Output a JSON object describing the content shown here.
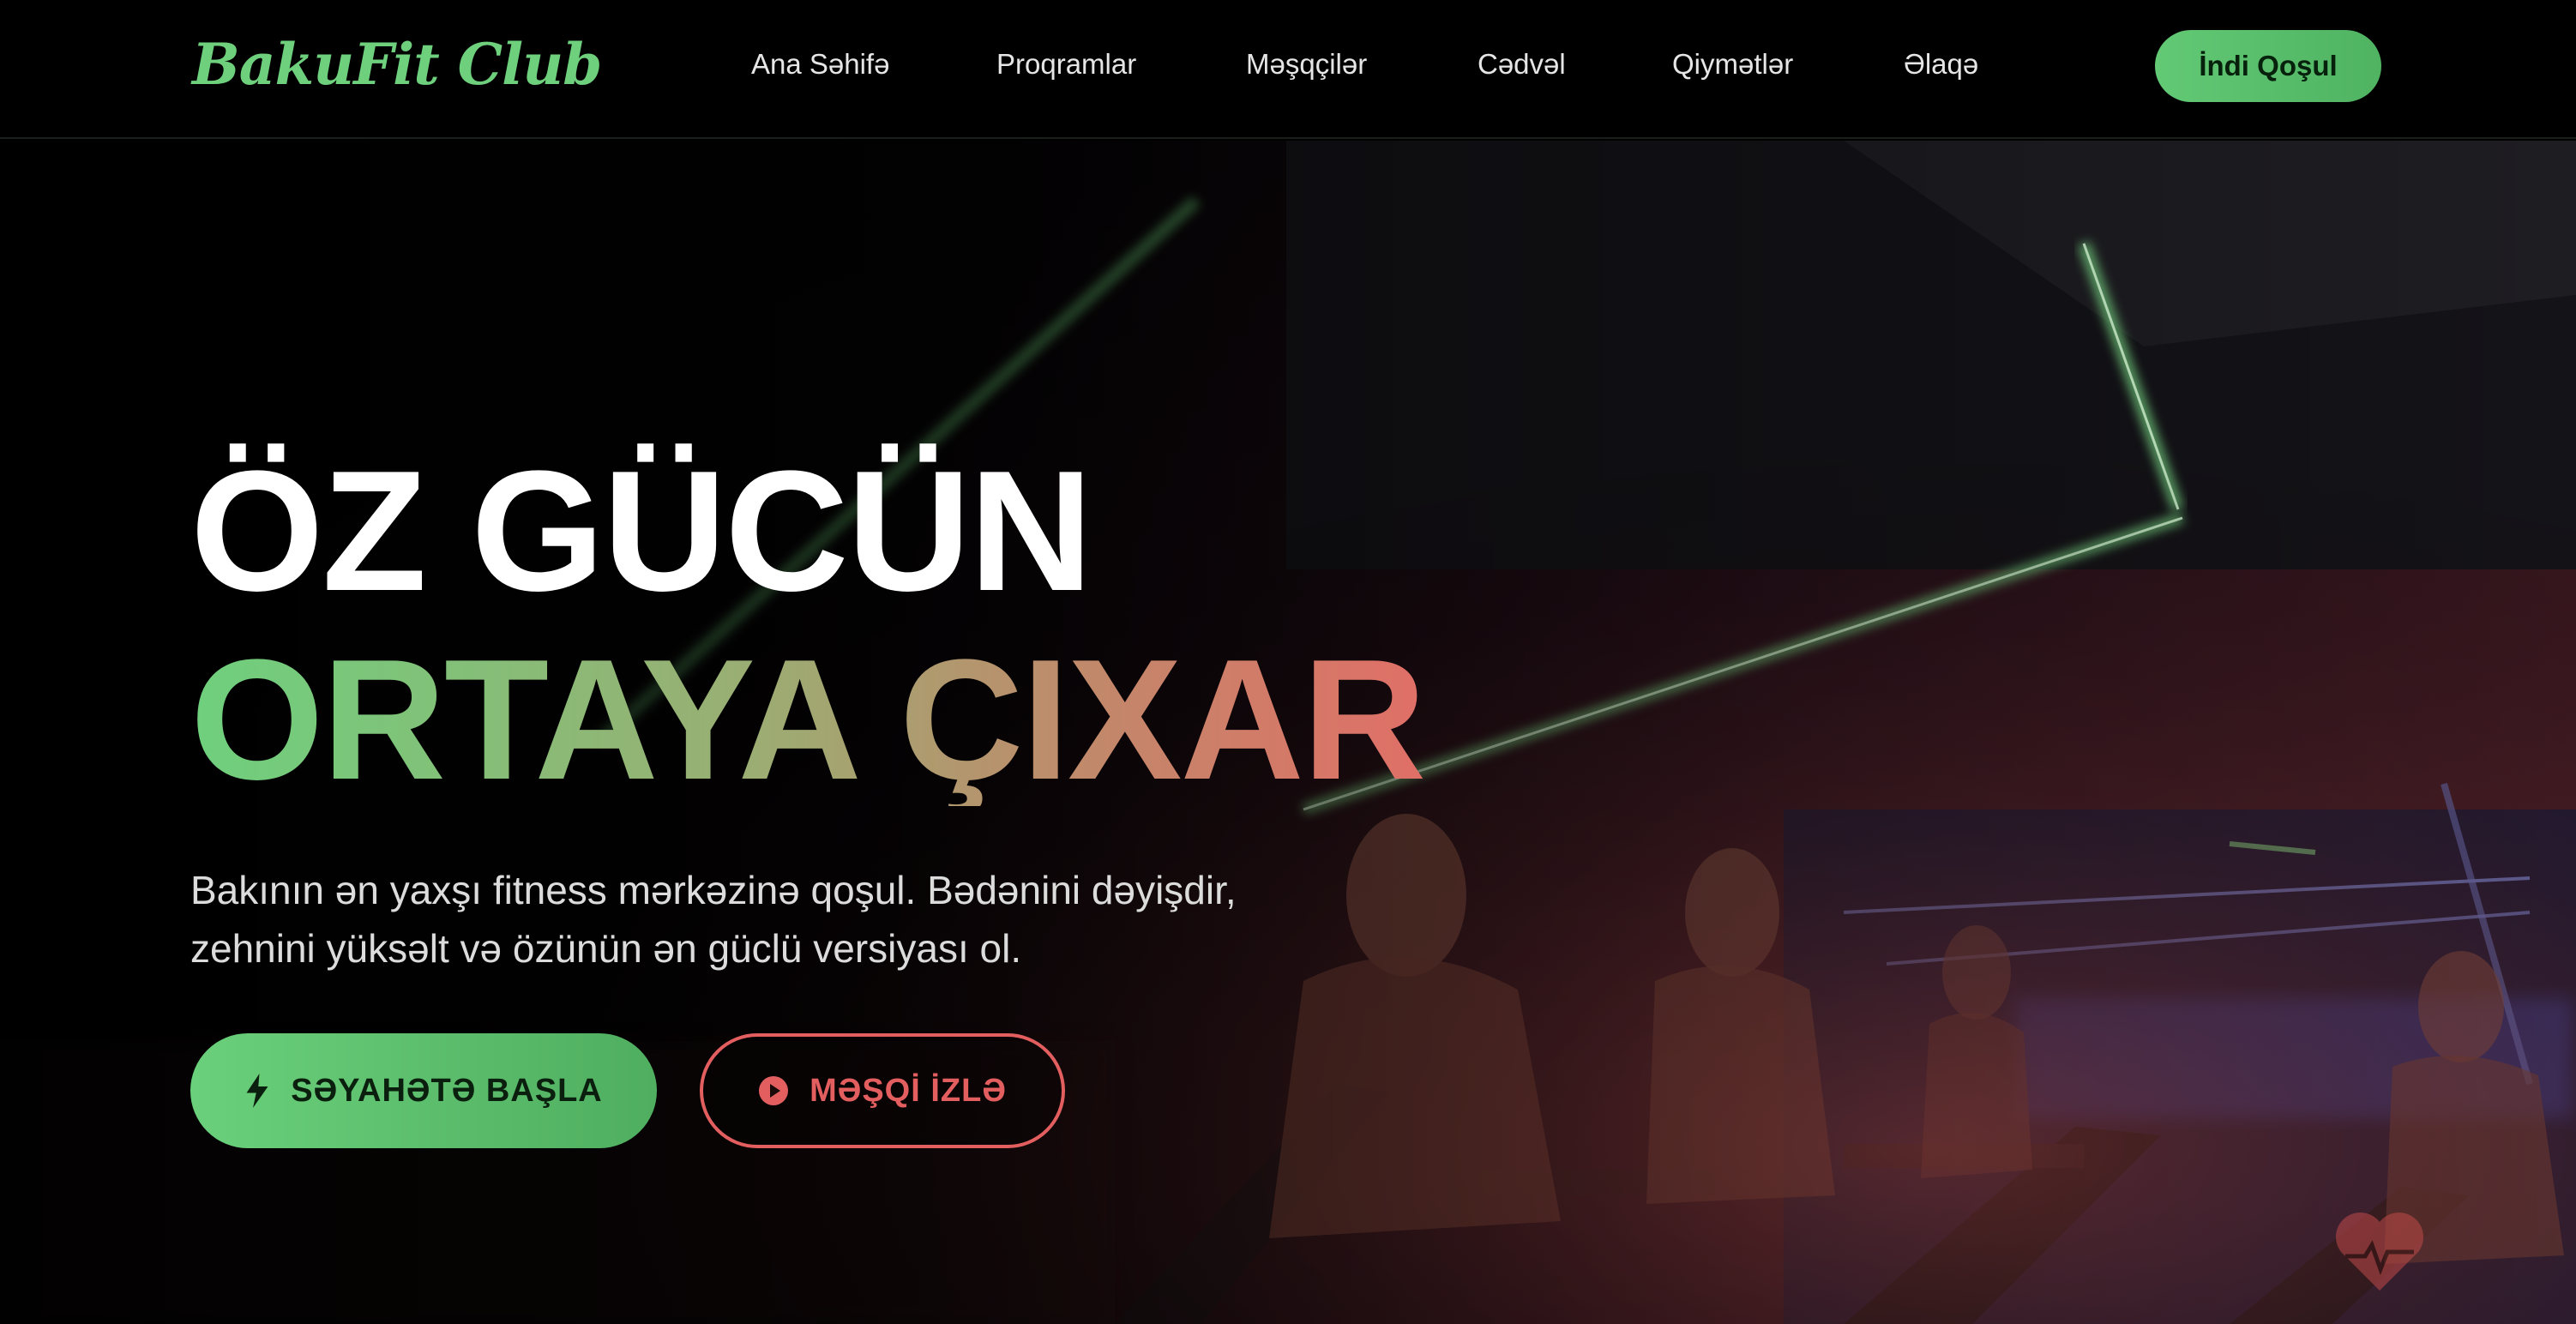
{
  "brand": {
    "name": "BakuFit Club",
    "color": "#6ed07d"
  },
  "nav": {
    "items": [
      {
        "label": "Ana Səhifə"
      },
      {
        "label": "Proqramlar"
      },
      {
        "label": "Məşqçilər"
      },
      {
        "label": "Cədvəl"
      },
      {
        "label": "Qiymətlər"
      },
      {
        "label": "Əlaqə"
      }
    ],
    "cta_label": "İndi Qoşul"
  },
  "hero": {
    "headline_line1": "ÖZ GÜCÜN",
    "headline_line2": "ORTAYA ÇIXAR",
    "tagline_line1": "Bakının ən yaxşı fitness mərkəzinə qoşul. Bədənini dəyişdir,",
    "tagline_line2": "zehnini yüksəlt və özünün ən güclü versiyası ol.",
    "primary_button": {
      "label": "SƏYAHƏTƏ BAŞLA",
      "icon": "lightning-bolt-icon"
    },
    "secondary_button": {
      "label": "MƏŞQİ İZLƏ",
      "icon": "play-circle-icon"
    },
    "decor_icon": "heart-pulse-icon"
  },
  "colors": {
    "accent_green": "#62c975",
    "accent_red": "#e35f5f",
    "background": "#000000"
  }
}
